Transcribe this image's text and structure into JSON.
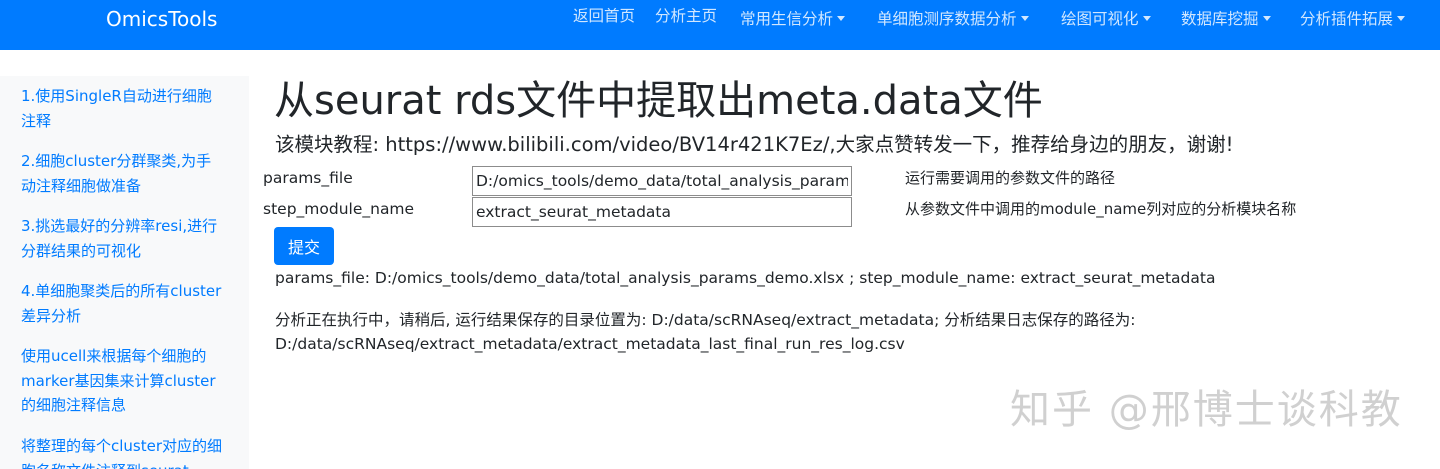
{
  "navbar": {
    "brand": "OmicsTools",
    "items": [
      {
        "label": "返回首页",
        "dropdown": false
      },
      {
        "label": "分析主页",
        "dropdown": false
      },
      {
        "label": "常用生信分析",
        "dropdown": true
      },
      {
        "label": "单细胞测序数据分析",
        "dropdown": true
      },
      {
        "label": "绘图可视化",
        "dropdown": true
      },
      {
        "label": "数据库挖掘",
        "dropdown": true
      },
      {
        "label": "分析插件拓展",
        "dropdown": true
      }
    ]
  },
  "sidebar": {
    "items": [
      {
        "label": "1.使用SingleR自动进行细胞注释"
      },
      {
        "label": "2.细胞cluster分群聚类,为手动注释细胞做准备"
      },
      {
        "label": "3.挑选最好的分辨率resi,进行分群结果的可视化"
      },
      {
        "label": "4.单细胞聚类后的所有cluster差异分析"
      },
      {
        "label": "使用ucell来根据每个细胞的marker基因集来计算cluster的细胞注释信息"
      },
      {
        "label": "将整理的每个cluster对应的细胞名称文件注释到seurat"
      }
    ]
  },
  "main": {
    "title": "从seurat rds文件中提取出meta.data文件",
    "tutorial": "该模块教程: https://www.bilibili.com/video/BV14r421K7Ez/,大家点赞转发一下，推荐给身边的朋友，谢谢!",
    "params": [
      {
        "label": "params_file",
        "value": "D:/omics_tools/demo_data/total_analysis_params_demo.xlsx",
        "desc": "运行需要调用的参数文件的路径"
      },
      {
        "label": "step_module_name",
        "value": "extract_seurat_metadata",
        "desc": "从参数文件中调用的module_name列对应的分析模块名称"
      }
    ],
    "submit_label": "提交",
    "result_summary": "params_file: D:/omics_tools/demo_data/total_analysis_params_demo.xlsx ; step_module_name: extract_seurat_metadata",
    "status_line1": "分析正在执行中，请稍后, 运行结果保存的目录位置为: D:/data/scRNAseq/extract_metadata; 分析结果日志保存的路径为:",
    "status_line2": "D:/data/scRNAseq/extract_metadata/extract_metadata_last_final_run_res_log.csv"
  },
  "watermark": "知乎 @邢博士谈科教",
  "colors": {
    "navbar": "#007bff",
    "link": "#007bff",
    "sidebar_bg": "#f8f9fa",
    "button": "#007bff"
  }
}
